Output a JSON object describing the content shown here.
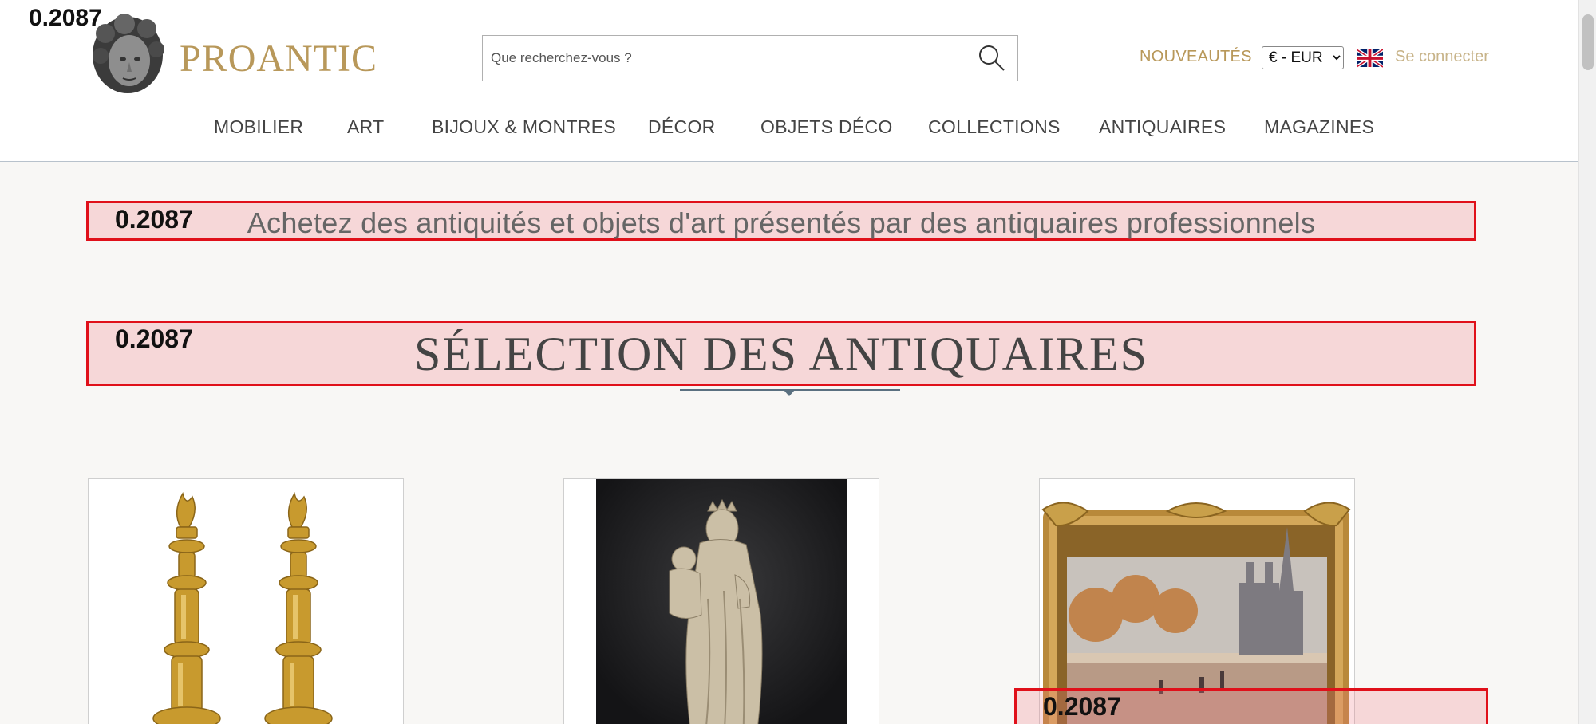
{
  "header": {
    "brand": "PROANTIC",
    "search_placeholder": "Que recherchez-vous ?",
    "nouveautes": "NOUVEAUTÉS",
    "currency": "€ - EUR",
    "login": "Se connecter"
  },
  "nav": [
    "MOBILIER",
    "ART",
    "BIJOUX & MONTRES",
    "DÉCOR",
    "OBJETS DÉCO",
    "COLLECTIONS",
    "ANTIQUAIRES",
    "MAGAZINES"
  ],
  "tagline": "Achetez des antiquités et objets d'art présentés par des antiquaires professionnels",
  "section_title": "SÉLECTION DES ANTIQUAIRES",
  "annotations": {
    "top_label": "0.2087",
    "tagline_label": "0.2087",
    "title_label": "0.2087",
    "card_label": "0.2087"
  },
  "colors": {
    "brand_gold": "#b8985a",
    "annotation_red": "#e0101a"
  },
  "icons": [
    "search-icon",
    "uk-flag-icon",
    "logo-head-icon"
  ]
}
